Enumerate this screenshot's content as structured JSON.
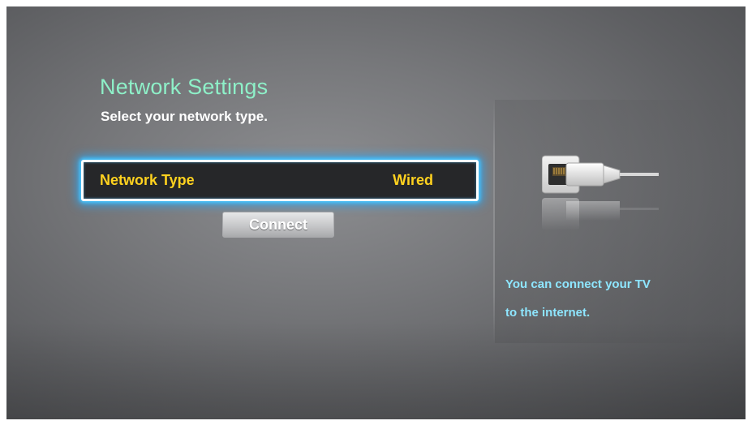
{
  "header": {
    "title": "Network Settings",
    "subtitle": "Select your network type."
  },
  "settings": {
    "network_type": {
      "label": "Network Type",
      "value": "Wired"
    }
  },
  "actions": {
    "connect_label": "Connect"
  },
  "help_panel": {
    "icon": "lan-port-icon",
    "lines": [
      "You can connect your TV",
      "to the internet."
    ]
  },
  "colors": {
    "title": "#8ef0c8",
    "focus_text": "#ffd21f",
    "focus_glow": "#48c8ff",
    "help_text": "#8ee6ff"
  }
}
